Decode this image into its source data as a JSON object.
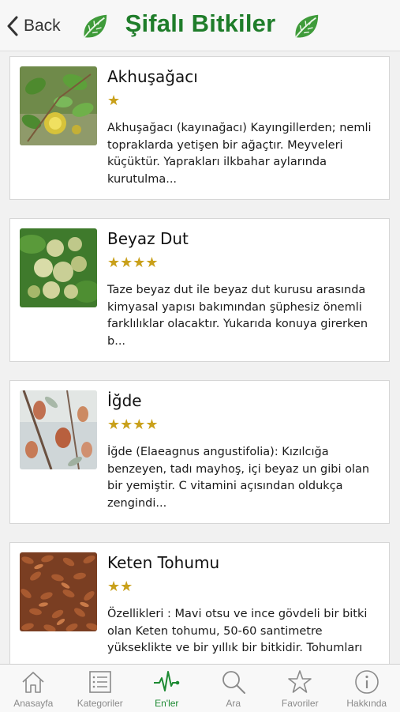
{
  "header": {
    "back_label": "Back",
    "title": "Şifalı Bitkiler"
  },
  "plants": [
    {
      "name": "Akhuşağacı",
      "rating": 1,
      "stars": "★",
      "description": "Akhuşağacı (kayınağacı) Kayıngillerden; nemli topraklarda yetişen bir ağaçtır. Meyveleri küçüktür. Yaprakları ilkbahar aylarında kurutulma..."
    },
    {
      "name": "Beyaz Dut",
      "rating": 4,
      "stars": "★★★★",
      "description": "Taze beyaz dut ile beyaz dut kurusu arasında kimyasal yapısı bakımından şüphesiz önemli farklılıklar olacaktır. Yukarıda konuya girerken b..."
    },
    {
      "name": "İğde",
      "rating": 4,
      "stars": "★★★★",
      "description": "İğde (Elaeagnus angustifolia): Kızılcığa benzeyen, tadı mayhoş, içi beyaz un gibi olan bir yemiştir. C vitamini açısından oldukça zengindi..."
    },
    {
      "name": "Keten Tohumu",
      "rating": 2,
      "stars": "★★",
      "description": "Özellikleri : Mavi otsu ve ince gövdeli bir bitki olan Keten tohumu, 50-60 santimetre yükseklikte ve bir yıllık bir bitkidir. Tohumları"
    }
  ],
  "tabs": [
    {
      "label": "Anasayfa",
      "icon": "home-icon"
    },
    {
      "label": "Kategoriler",
      "icon": "list-icon"
    },
    {
      "label": "En'ler",
      "icon": "pulse-icon",
      "active": true
    },
    {
      "label": "Ara",
      "icon": "search-icon"
    },
    {
      "label": "Favoriler",
      "icon": "star-icon"
    },
    {
      "label": "Hakkında",
      "icon": "info-icon"
    }
  ],
  "colors": {
    "brand_green": "#1f7d2a",
    "star_gold": "#c9a01a",
    "active_tab": "#1c8a32",
    "inactive_tab": "#8a8a8a"
  }
}
